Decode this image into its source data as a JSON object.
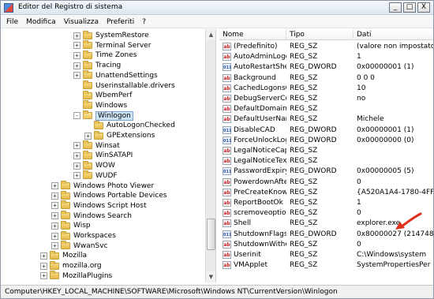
{
  "window": {
    "title": "Editor del Registro di sistema",
    "minimize": "_",
    "maximize": "□",
    "close": "X"
  },
  "menu": [
    "File",
    "Modifica",
    "Visualizza",
    "Preferiti",
    "?"
  ],
  "tree": [
    {
      "label": "SystemRestore",
      "level": 3,
      "expander": "+",
      "open": false
    },
    {
      "label": "Terminal Server",
      "level": 3,
      "expander": "+",
      "open": false
    },
    {
      "label": "Time Zones",
      "level": 3,
      "expander": "+",
      "open": false
    },
    {
      "label": "Tracing",
      "level": 3,
      "expander": "+",
      "open": false
    },
    {
      "label": "UnattendSettings",
      "level": 3,
      "expander": "+",
      "open": false
    },
    {
      "label": "Userinstallable.drivers",
      "level": 3,
      "expander": "",
      "open": false
    },
    {
      "label": "WbemPerf",
      "level": 3,
      "expander": "",
      "open": false
    },
    {
      "label": "Windows",
      "level": 3,
      "expander": "",
      "open": false
    },
    {
      "label": "Winlogon",
      "level": 3,
      "expander": "-",
      "open": true,
      "selected": true
    },
    {
      "label": "AutoLogonChecked",
      "level": 4,
      "expander": "",
      "open": false
    },
    {
      "label": "GPExtensions",
      "level": 4,
      "expander": "+",
      "open": false
    },
    {
      "label": "Winsat",
      "level": 3,
      "expander": "+",
      "open": false
    },
    {
      "label": "WinSATAPI",
      "level": 3,
      "expander": "+",
      "open": false
    },
    {
      "label": "WOW",
      "level": 3,
      "expander": "+",
      "open": false
    },
    {
      "label": "WUDF",
      "level": 3,
      "expander": "+",
      "open": false
    },
    {
      "label": "Windows Photo Viewer",
      "level": 2,
      "expander": "+",
      "open": false
    },
    {
      "label": "Windows Portable Devices",
      "level": 2,
      "expander": "+",
      "open": false
    },
    {
      "label": "Windows Script Host",
      "level": 2,
      "expander": "+",
      "open": false
    },
    {
      "label": "Windows Search",
      "level": 2,
      "expander": "+",
      "open": false
    },
    {
      "label": "Wisp",
      "level": 2,
      "expander": "+",
      "open": false
    },
    {
      "label": "Workspaces",
      "level": 2,
      "expander": "+",
      "open": false
    },
    {
      "label": "WwanSvc",
      "level": 2,
      "expander": "+",
      "open": false
    },
    {
      "label": "Mozilla",
      "level": 1,
      "expander": "+",
      "open": false
    },
    {
      "label": "mozilla.org",
      "level": 1,
      "expander": "+",
      "open": false
    },
    {
      "label": "MozillaPlugins",
      "level": 1,
      "expander": "+",
      "open": false
    }
  ],
  "columns": {
    "name": "Nome",
    "type": "Tipo",
    "data": "Dati"
  },
  "values": [
    {
      "icon": "ab",
      "name": "(Predefinito)",
      "type": "REG_SZ",
      "data": "(valore non impostato)"
    },
    {
      "icon": "ab",
      "name": "AutoAdminLogon",
      "type": "REG_SZ",
      "data": "1"
    },
    {
      "icon": "bin",
      "name": "AutoRestartShell",
      "type": "REG_DWORD",
      "data": "0x00000001 (1)"
    },
    {
      "icon": "ab",
      "name": "Background",
      "type": "REG_SZ",
      "data": "0 0 0"
    },
    {
      "icon": "ab",
      "name": "CachedLogonsC...",
      "type": "REG_SZ",
      "data": "10"
    },
    {
      "icon": "ab",
      "name": "DebugServerCo...",
      "type": "REG_SZ",
      "data": "no"
    },
    {
      "icon": "ab",
      "name": "DefaultDomain...",
      "type": "REG_SZ",
      "data": ""
    },
    {
      "icon": "ab",
      "name": "DefaultUserName",
      "type": "REG_SZ",
      "data": "Michele"
    },
    {
      "icon": "bin",
      "name": "DisableCAD",
      "type": "REG_DWORD",
      "data": "0x00000001 (1)"
    },
    {
      "icon": "bin",
      "name": "ForceUnlockLog...",
      "type": "REG_DWORD",
      "data": "0x00000000 (0)"
    },
    {
      "icon": "ab",
      "name": "LegalNoticeCap...",
      "type": "REG_SZ",
      "data": ""
    },
    {
      "icon": "ab",
      "name": "LegalNoticeText",
      "type": "REG_SZ",
      "data": ""
    },
    {
      "icon": "bin",
      "name": "PasswordExpiry...",
      "type": "REG_DWORD",
      "data": "0x00000005 (5)"
    },
    {
      "icon": "ab",
      "name": "PowerdownAfte...",
      "type": "REG_SZ",
      "data": "0"
    },
    {
      "icon": "ab",
      "name": "PreCreateKnow...",
      "type": "REG_SZ",
      "data": "{A520A1A4-1780-4FF"
    },
    {
      "icon": "ab",
      "name": "ReportBootOk",
      "type": "REG_SZ",
      "data": "1"
    },
    {
      "icon": "ab",
      "name": "scremoveoption",
      "type": "REG_SZ",
      "data": "0"
    },
    {
      "icon": "ab",
      "name": "Shell",
      "type": "REG_SZ",
      "data": "explorer.exe"
    },
    {
      "icon": "bin",
      "name": "ShutdownFlags",
      "type": "REG_DWORD",
      "data": "0x80000027 (2147483"
    },
    {
      "icon": "ab",
      "name": "ShutdownWitho...",
      "type": "REG_SZ",
      "data": "0"
    },
    {
      "icon": "ab",
      "name": "Userinit",
      "type": "REG_SZ",
      "data": "C:\\Windows\\system"
    },
    {
      "icon": "ab",
      "name": "VMApplet",
      "type": "REG_SZ",
      "data": "SystemPropertiesPer"
    }
  ],
  "icon_text": {
    "ab": "ab",
    "bin": "011"
  },
  "status": "Computer\\HKEY_LOCAL_MACHINE\\SOFTWARE\\Microsoft\\Windows NT\\CurrentVersion\\Winlogon",
  "colors": {
    "selection": "#cde4f7",
    "annotation_arrow": "#e0301e"
  }
}
